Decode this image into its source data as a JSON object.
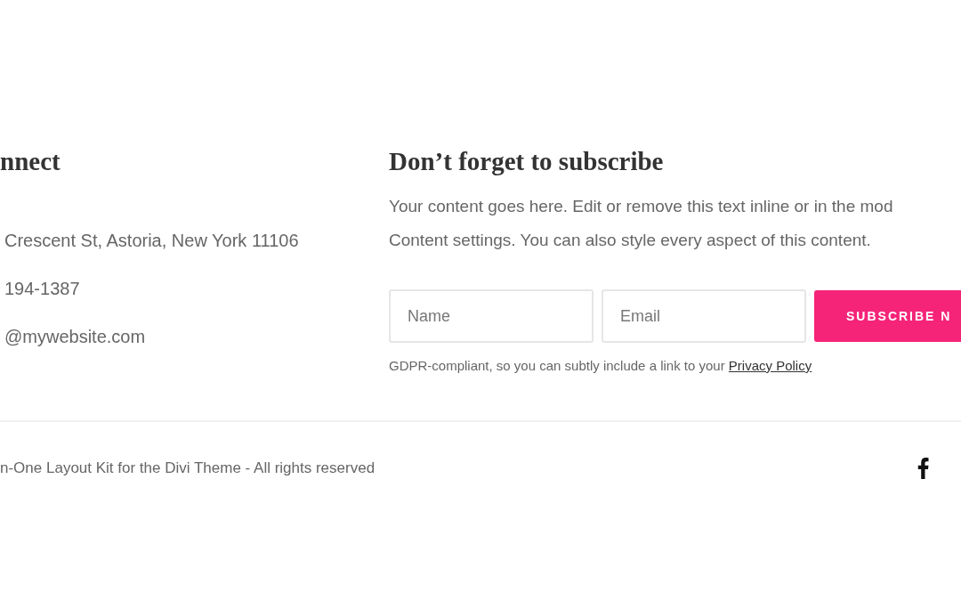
{
  "contact": {
    "heading": "nnect",
    "items": [
      {
        "text": "Crescent St, Astoria, New York 11106"
      },
      {
        "text": "194-1387"
      },
      {
        "text": "@mywebsite.com"
      }
    ]
  },
  "subscribe": {
    "heading": "Don’t forget to subscribe",
    "description_lines": [
      "Your content goes here. Edit or remove this text inline or in the mod",
      "Content settings. You can also style every aspect of this content."
    ],
    "name_field": {
      "placeholder": "Name"
    },
    "email_field": {
      "placeholder": "Email"
    },
    "button": "SUBSCRIBE N",
    "note": "GDPR-compliant, so you can subtly include a link to your",
    "note_link": "Privacy Policy"
  },
  "footer": {
    "copyright": "n-One Layout Kit for the Divi Theme - All rights reserved"
  }
}
